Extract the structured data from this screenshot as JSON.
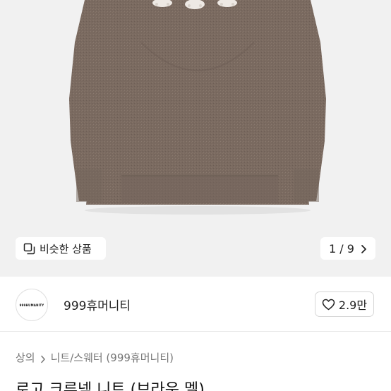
{
  "gallery": {
    "similar_label": "비슷한 상품",
    "pager_text": "1 / 9"
  },
  "shop": {
    "avatar_text": "999HUMANITY",
    "name": "999휴머니티",
    "like_count": "2.9만"
  },
  "breadcrumb": {
    "level1": "상의",
    "level2": "니트/스웨터 (999휴머니티)"
  },
  "product": {
    "title": "로고 크루넥 니트 (브라운 멜)"
  },
  "colors": {
    "sweater": "#7d6c62",
    "image_bg": "#f1f1f1"
  }
}
